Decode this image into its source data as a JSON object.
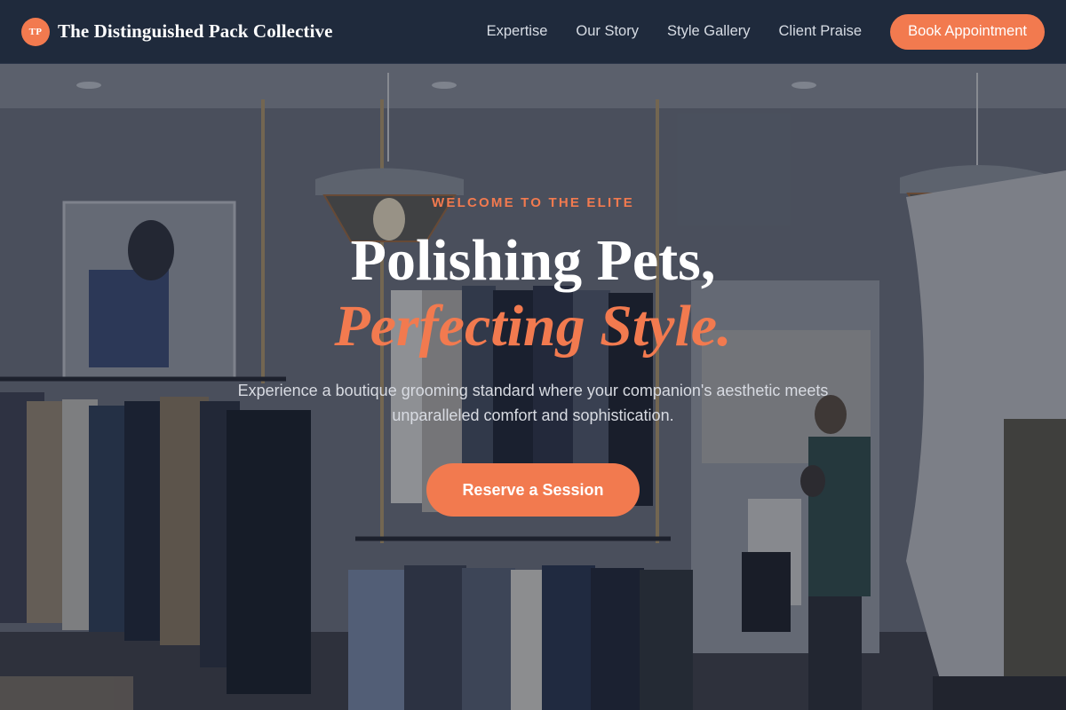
{
  "brand": {
    "logo_initials": "TP",
    "name": "The Distinguished Pack Collective"
  },
  "nav": {
    "links": [
      "Expertise",
      "Our Story",
      "Style Gallery",
      "Client Praise"
    ],
    "cta_label": "Book Appointment"
  },
  "hero": {
    "eyebrow": "WELCOME TO THE ELITE",
    "headline_line1": "Polishing Pets,",
    "headline_line2": "Perfecting Style.",
    "subtext": "Experience a boutique grooming standard where your companion's aesthetic meets unparalleled comfort and sophistication.",
    "cta_label": "Reserve a Session",
    "background_image": "clothing-boutique-interior-photo"
  },
  "colors": {
    "accent": "#f27a4f",
    "nav_bg": "#1f2a3c",
    "text_light": "#ffffff"
  }
}
